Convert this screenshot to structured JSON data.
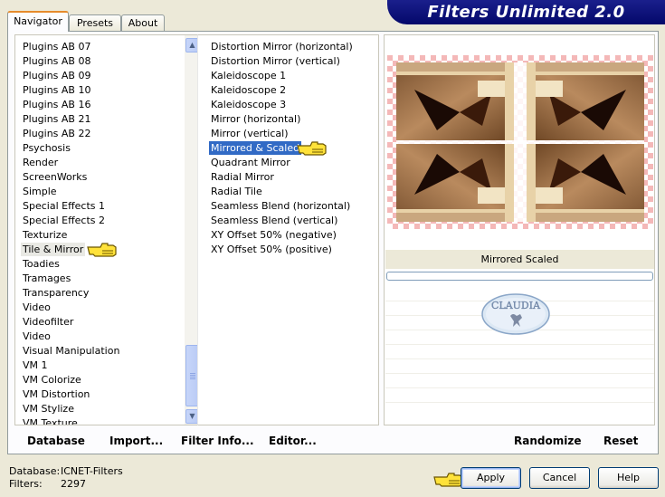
{
  "title": "Filters Unlimited 2.0",
  "tabs": [
    "Navigator",
    "Presets",
    "About"
  ],
  "categories": [
    "Plugins AB 07",
    "Plugins AB 08",
    "Plugins AB 09",
    "Plugins AB 10",
    "Plugins AB 16",
    "Plugins AB 21",
    "Plugins AB 22",
    "Psychosis",
    "Render",
    "ScreenWorks",
    "Simple",
    "Special Effects 1",
    "Special Effects 2",
    "Texturize",
    "Tile & Mirror",
    "Toadies",
    "Tramages",
    "Transparency",
    "Video",
    "Videofilter",
    "Video",
    "Visual Manipulation",
    "VM 1",
    "VM Colorize",
    "VM Distortion",
    "VM Stylize",
    "VM Texture"
  ],
  "selected_category": "Tile & Mirror",
  "filters": [
    "Distortion Mirror (horizontal)",
    "Distortion Mirror (vertical)",
    "Kaleidoscope 1",
    "Kaleidoscope 2",
    "Kaleidoscope 3",
    "Mirror (horizontal)",
    "Mirror (vertical)",
    "Mirrored & Scaled",
    "Quadrant Mirror",
    "Radial Mirror",
    "Radial Tile",
    "Seamless Blend (horizontal)",
    "Seamless Blend (vertical)",
    "XY Offset 50% (negative)",
    "XY Offset 50% (positive)"
  ],
  "selected_filter": "Mirrored & Scaled",
  "preview_filter_name": "Mirrored  Scaled",
  "watermark_text": "CLAUDIA",
  "toolbar": {
    "database": "Database",
    "import": "Import...",
    "filter_info": "Filter Info...",
    "editor": "Editor...",
    "randomize": "Randomize",
    "reset": "Reset"
  },
  "status": {
    "database_label": "Database:",
    "database_value": "ICNET-Filters",
    "filters_label": "Filters:",
    "filters_value": "2297"
  },
  "buttons": {
    "apply": "Apply",
    "cancel": "Cancel",
    "help": "Help"
  },
  "colors": {
    "selection": "#316ac5",
    "banner": "#0b1078",
    "tab_accent": "#e68b2c"
  },
  "icons": {
    "pointer": "pointing-hand-icon"
  }
}
